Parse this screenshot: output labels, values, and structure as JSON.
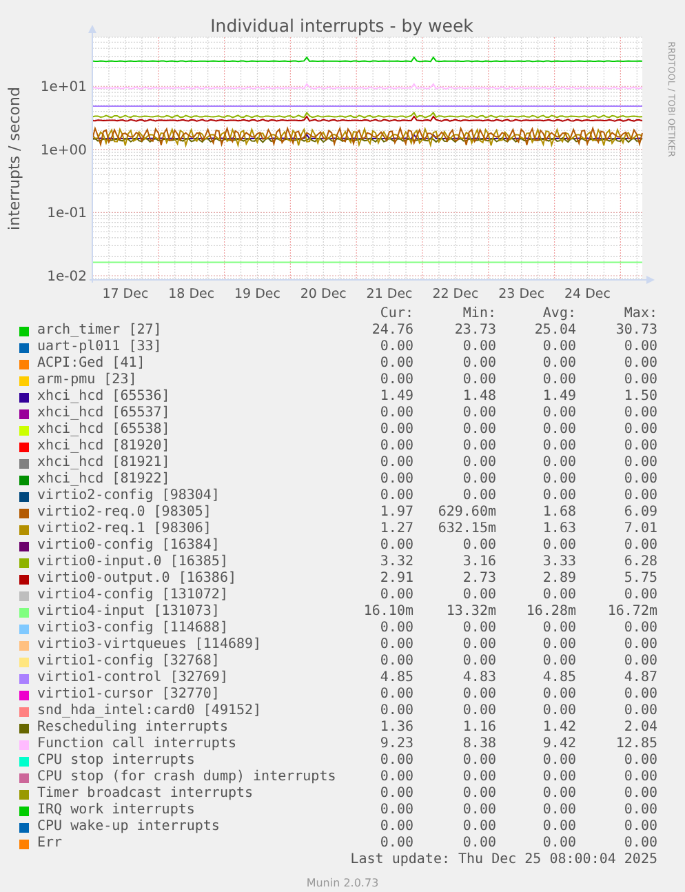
{
  "chart": {
    "title": "Individual interrupts - by week",
    "ylabel": "interrupts / second",
    "xticks": [
      "17 Dec",
      "18 Dec",
      "19 Dec",
      "20 Dec",
      "21 Dec",
      "22 Dec",
      "23 Dec",
      "24 Dec"
    ],
    "yticks": [
      "1e+01",
      "1e+00",
      "1e-01",
      "1e-02"
    ],
    "side_text": "RRDTOOL / TOBI OETIKER"
  },
  "legend": {
    "columns": [
      "Cur:",
      "Min:",
      "Avg:",
      "Max:"
    ],
    "rows": [
      {
        "name": "arch_timer [27]",
        "color": "#00cc00",
        "cur": "24.76",
        "min": "23.73",
        "avg": "25.04",
        "max": "30.73"
      },
      {
        "name": "uart-pl011 [33]",
        "color": "#0066b3",
        "cur": "0.00",
        "min": "0.00",
        "avg": "0.00",
        "max": "0.00"
      },
      {
        "name": "ACPI:Ged [41]",
        "color": "#ff8000",
        "cur": "0.00",
        "min": "0.00",
        "avg": "0.00",
        "max": "0.00"
      },
      {
        "name": "arm-pmu [23]",
        "color": "#ffcc00",
        "cur": "0.00",
        "min": "0.00",
        "avg": "0.00",
        "max": "0.00"
      },
      {
        "name": "xhci_hcd [65536]",
        "color": "#330099",
        "cur": "1.49",
        "min": "1.48",
        "avg": "1.49",
        "max": "1.50"
      },
      {
        "name": "xhci_hcd [65537]",
        "color": "#990099",
        "cur": "0.00",
        "min": "0.00",
        "avg": "0.00",
        "max": "0.00"
      },
      {
        "name": "xhci_hcd [65538]",
        "color": "#ccff00",
        "cur": "0.00",
        "min": "0.00",
        "avg": "0.00",
        "max": "0.00"
      },
      {
        "name": "xhci_hcd [81920]",
        "color": "#ff0000",
        "cur": "0.00",
        "min": "0.00",
        "avg": "0.00",
        "max": "0.00"
      },
      {
        "name": "xhci_hcd [81921]",
        "color": "#808080",
        "cur": "0.00",
        "min": "0.00",
        "avg": "0.00",
        "max": "0.00"
      },
      {
        "name": "xhci_hcd [81922]",
        "color": "#008f00",
        "cur": "0.00",
        "min": "0.00",
        "avg": "0.00",
        "max": "0.00"
      },
      {
        "name": "virtio2-config [98304]",
        "color": "#00487d",
        "cur": "0.00",
        "min": "0.00",
        "avg": "0.00",
        "max": "0.00"
      },
      {
        "name": "virtio2-req.0 [98305]",
        "color": "#b35900",
        "cur": "1.97",
        "min": "629.60m",
        "avg": "1.68",
        "max": "6.09"
      },
      {
        "name": "virtio2-req.1 [98306]",
        "color": "#b38f00",
        "cur": "1.27",
        "min": "632.15m",
        "avg": "1.63",
        "max": "7.01"
      },
      {
        "name": "virtio0-config [16384]",
        "color": "#6b006b",
        "cur": "0.00",
        "min": "0.00",
        "avg": "0.00",
        "max": "0.00"
      },
      {
        "name": "virtio0-input.0 [16385]",
        "color": "#8fb300",
        "cur": "3.32",
        "min": "3.16",
        "avg": "3.33",
        "max": "6.28"
      },
      {
        "name": "virtio0-output.0 [16386]",
        "color": "#b30000",
        "cur": "2.91",
        "min": "2.73",
        "avg": "2.89",
        "max": "5.75"
      },
      {
        "name": "virtio4-config [131072]",
        "color": "#bebebe",
        "cur": "0.00",
        "min": "0.00",
        "avg": "0.00",
        "max": "0.00"
      },
      {
        "name": "virtio4-input [131073]",
        "color": "#80ff80",
        "cur": "16.10m",
        "min": "13.32m",
        "avg": "16.28m",
        "max": "16.72m"
      },
      {
        "name": "virtio3-config [114688]",
        "color": "#80c9ff",
        "cur": "0.00",
        "min": "0.00",
        "avg": "0.00",
        "max": "0.00"
      },
      {
        "name": "virtio3-virtqueues [114689]",
        "color": "#ffc080",
        "cur": "0.00",
        "min": "0.00",
        "avg": "0.00",
        "max": "0.00"
      },
      {
        "name": "virtio1-config [32768]",
        "color": "#ffe680",
        "cur": "0.00",
        "min": "0.00",
        "avg": "0.00",
        "max": "0.00"
      },
      {
        "name": "virtio1-control [32769]",
        "color": "#aa80ff",
        "cur": "4.85",
        "min": "4.83",
        "avg": "4.85",
        "max": "4.87"
      },
      {
        "name": "virtio1-cursor [32770]",
        "color": "#ee00cc",
        "cur": "0.00",
        "min": "0.00",
        "avg": "0.00",
        "max": "0.00"
      },
      {
        "name": "snd_hda_intel:card0 [49152]",
        "color": "#ff8080",
        "cur": "0.00",
        "min": "0.00",
        "avg": "0.00",
        "max": "0.00"
      },
      {
        "name": "Rescheduling interrupts",
        "color": "#666600",
        "cur": "1.36",
        "min": "1.16",
        "avg": "1.42",
        "max": "2.04"
      },
      {
        "name": "Function call interrupts",
        "color": "#ffbbff",
        "cur": "9.23",
        "min": "8.38",
        "avg": "9.42",
        "max": "12.85"
      },
      {
        "name": "CPU stop interrupts",
        "color": "#00ffcc",
        "cur": "0.00",
        "min": "0.00",
        "avg": "0.00",
        "max": "0.00"
      },
      {
        "name": "CPU stop (for crash dump) interrupts",
        "color": "#cc6699",
        "cur": "0.00",
        "min": "0.00",
        "avg": "0.00",
        "max": "0.00"
      },
      {
        "name": "Timer broadcast interrupts",
        "color": "#999900",
        "cur": "0.00",
        "min": "0.00",
        "avg": "0.00",
        "max": "0.00"
      },
      {
        "name": "IRQ work interrupts",
        "color": "#00cc00",
        "cur": "0.00",
        "min": "0.00",
        "avg": "0.00",
        "max": "0.00"
      },
      {
        "name": "CPU wake-up interrupts",
        "color": "#0066b3",
        "cur": "0.00",
        "min": "0.00",
        "avg": "0.00",
        "max": "0.00"
      },
      {
        "name": "Err",
        "color": "#ff8000",
        "cur": "0.00",
        "min": "0.00",
        "avg": "0.00",
        "max": "0.00"
      }
    ],
    "last_update": "Last update: Thu Dec 25 08:00:04 2025"
  },
  "footer": "Munin 2.0.73"
}
